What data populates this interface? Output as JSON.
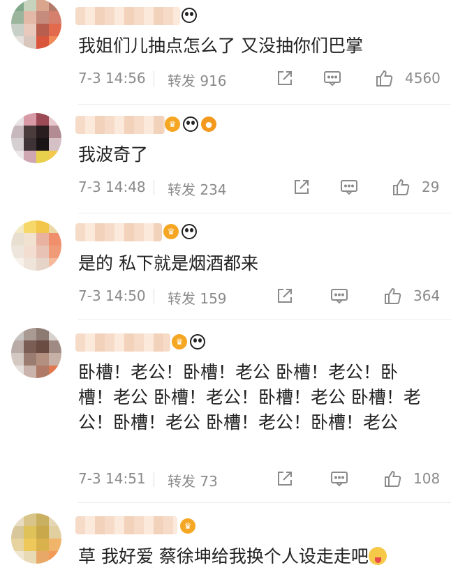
{
  "labels": {
    "repost": "转发"
  },
  "comments": [
    {
      "text": "我姐们儿抽点怎么了 又没抽你们巴掌",
      "time": "7-3 14:56",
      "reposts": "916",
      "likes": "4560",
      "badges": [
        "panda-badge"
      ]
    },
    {
      "text": "我波奇了",
      "time": "7-3 14:48",
      "reposts": "234",
      "likes": "29",
      "badges": [
        "crown-badge",
        "panda-badge",
        "fish-badge"
      ]
    },
    {
      "text": "是的 私下就是烟酒都来",
      "time": "7-3 14:50",
      "reposts": "159",
      "likes": "364",
      "badges": [
        "crown-badge",
        "panda-badge"
      ]
    },
    {
      "text": "卧槽！老公！卧槽！老公 卧槽！老公！卧槽！老公 卧槽！老公！卧槽！老公 卧槽！老公！卧槽！老公 卧槽！老公！卧槽！老公",
      "time": "7-3 14:51",
      "reposts": "73",
      "likes": "108",
      "badges": [
        "crown-badge",
        "panda-badge"
      ]
    },
    {
      "text": "草 我好爱 蔡徐坤给我换个人设走走吧",
      "emoji": "tongue-out-emoji",
      "badges": [
        "crown-badge"
      ]
    }
  ],
  "icons": {
    "share": "share-icon",
    "reply": "comment-icon",
    "like": "thumbs-up-icon"
  },
  "colors": {
    "meta_text": "#8a8a8a",
    "body_text": "#222222",
    "badge_orange": "#f5a623"
  }
}
